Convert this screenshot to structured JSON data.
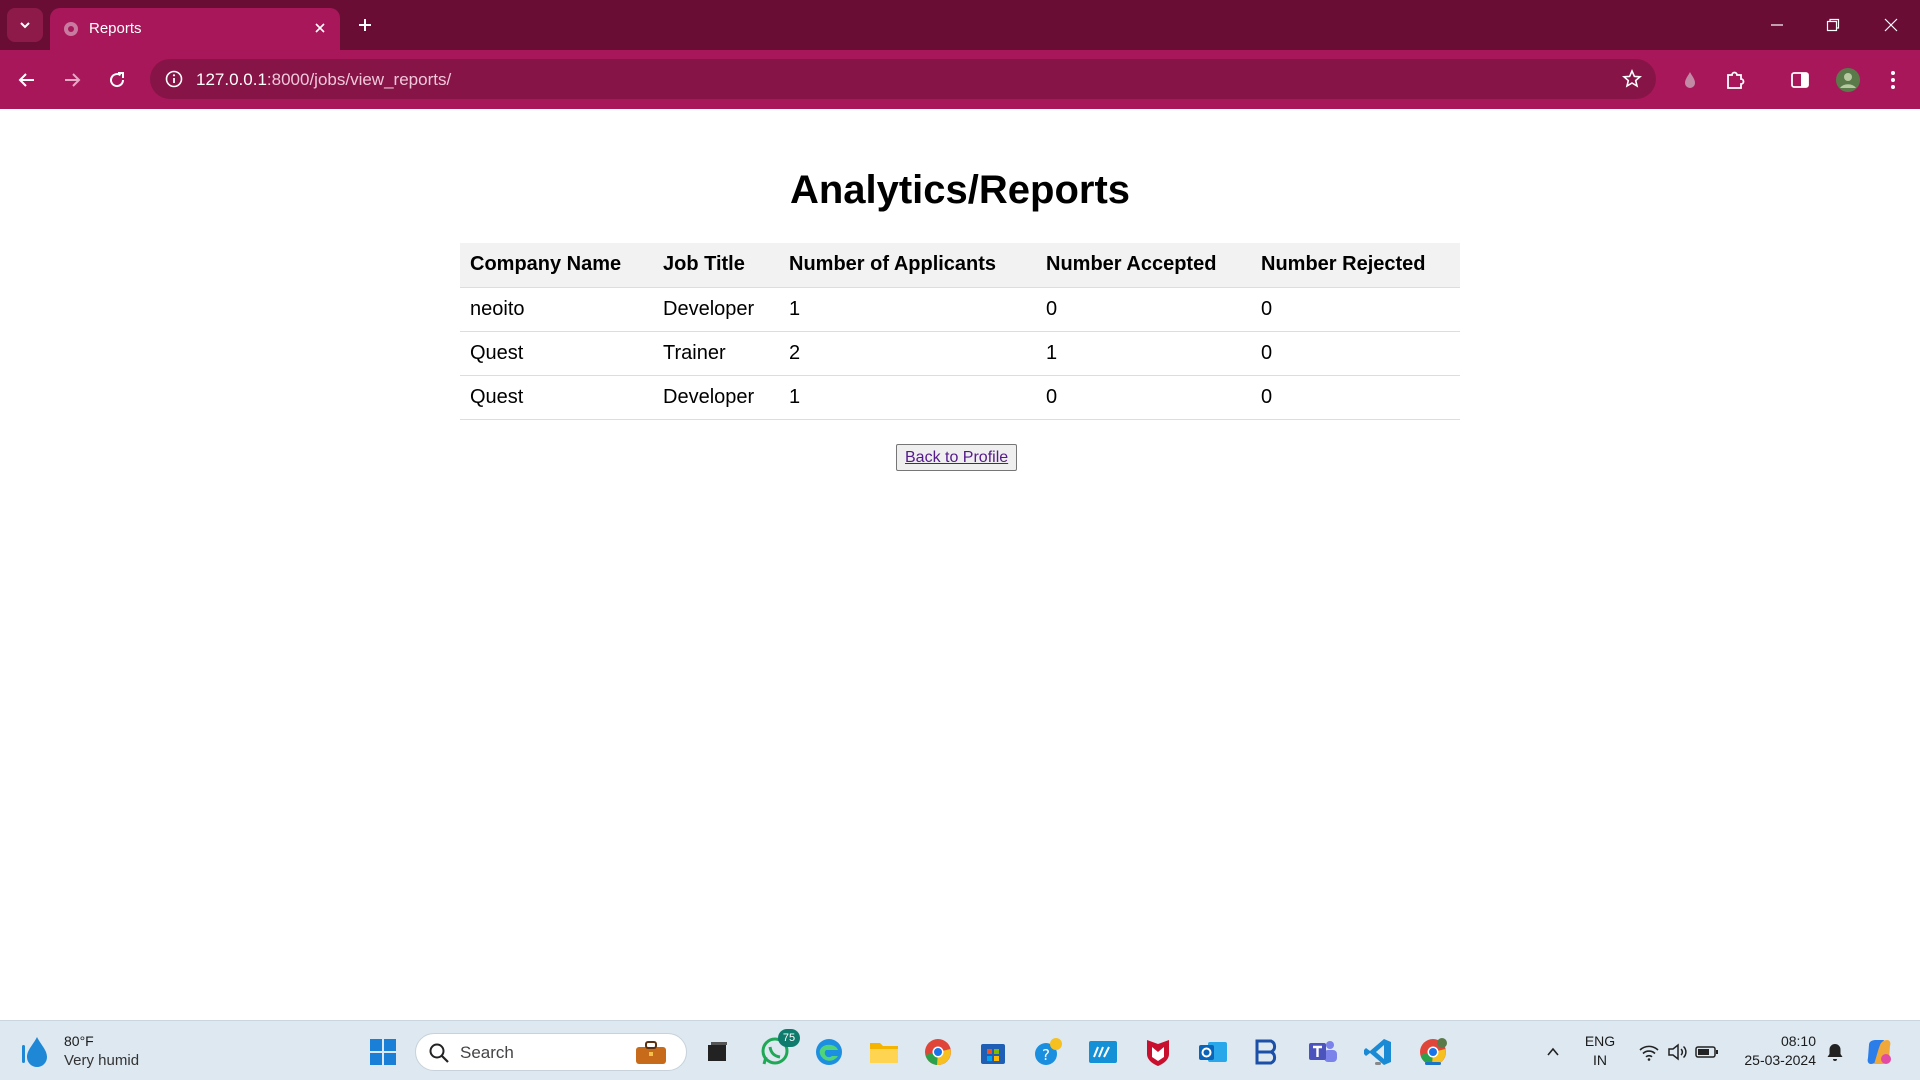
{
  "browser": {
    "tab_title": "Reports",
    "url_host": "127.0.0.1",
    "url_path": ":8000/jobs/view_reports/"
  },
  "page": {
    "title": "Analytics/Reports",
    "table": {
      "headers": [
        "Company Name",
        "Job Title",
        "Number of Applicants",
        "Number Accepted",
        "Number Rejected"
      ],
      "rows": [
        [
          "neoito",
          "Developer",
          "1",
          "0",
          "0"
        ],
        [
          "Quest",
          "Trainer",
          "2",
          "1",
          "0"
        ],
        [
          "Quest",
          "Developer",
          "1",
          "0",
          "0"
        ]
      ]
    },
    "back_button_label": "Back to Profile"
  },
  "taskbar": {
    "weather_temp": "80°F",
    "weather_desc": "Very humid",
    "search_placeholder": "Search",
    "whatsapp_badge": "75",
    "language_line1": "ENG",
    "language_line2": "IN",
    "time": "08:10",
    "date": "25-03-2024"
  },
  "colors": {
    "tabstrip": "#6a0d35",
    "toolbar": "#a8175a",
    "link": "#551a8b"
  }
}
